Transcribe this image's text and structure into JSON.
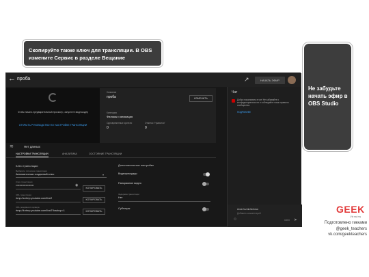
{
  "callouts": {
    "top": "Скопируйте также ключ для трансляции. В OBS измените Сервис в разделе Вещание",
    "right": "Не забудьте начать эфир в OBS Studio"
  },
  "app": {
    "title": "проба",
    "live_button": "НАЧАТЬ ЭФИР",
    "preview_text": "Чтобы начать предварительный просмотр, запустите видеокодер",
    "preview_link": "ОТКРЫТЬ РУКОВОДСТВО ПО НАСТРОЙКЕ ТРАНСЛЯЦИИ",
    "info": {
      "title_label": "Название",
      "title_value": "проба",
      "category_label": "Категория",
      "category_value": "Фильмы и анимация",
      "viewers_label": "Одновременные зрители",
      "viewers_value": "0",
      "likes_label": "Отметки \"Нравится\"",
      "likes_value": "0",
      "edit_button": "ИЗМЕНИТЬ"
    },
    "no_data": "Нет данных",
    "tabs": [
      "НАСТРОЙКИ ТРАНСЛЯЦИИ",
      "АНАЛИТИКА",
      "СОСТОЯНИЕ ТРАНСЛЯЦИИ"
    ],
    "stream_key": {
      "section": "Ключ трансляции",
      "select_label": "Выберите тип ключа трансляции",
      "select_value": "Автоматически созданный ключ",
      "key_label": "Ключ трансляции",
      "key_value": "••••••••••••••••••••",
      "url_label": "URL трансляции",
      "url_value": "rtmp://a.rtmp.youtube.com/live2",
      "backup_label": "URL резервного сервера",
      "backup_value": "rtmp://b.rtmp.youtube.com/live2?backup=1",
      "copy_button": "КОПИРОВАТЬ"
    },
    "settings": {
      "title": "Дополнительные настройки",
      "dvr": "Видеорекордер",
      "panorama": "Панорамное видео",
      "delay_label": "Задержка трансляции",
      "delay_value": "Нет",
      "subtitles": "Субтитры"
    },
    "chat": {
      "title": "Чат",
      "message": "Добро пожаловать в чат! Не забывайте о конфиденциальности и соблюдайте наши правила сообщества.",
      "link": "ПОДРОБНЕЕ",
      "user": "Anna Kuzmichenkova",
      "placeholder": "Добавить комментарий",
      "counter": "0/200"
    }
  },
  "branding": {
    "logo": "GEEK",
    "logo_sub": "//brains",
    "credit_line1": "Подготовлено гикками",
    "credit_line2": "@geek_teachers",
    "credit_line3": "vk.com/geekteachers"
  }
}
